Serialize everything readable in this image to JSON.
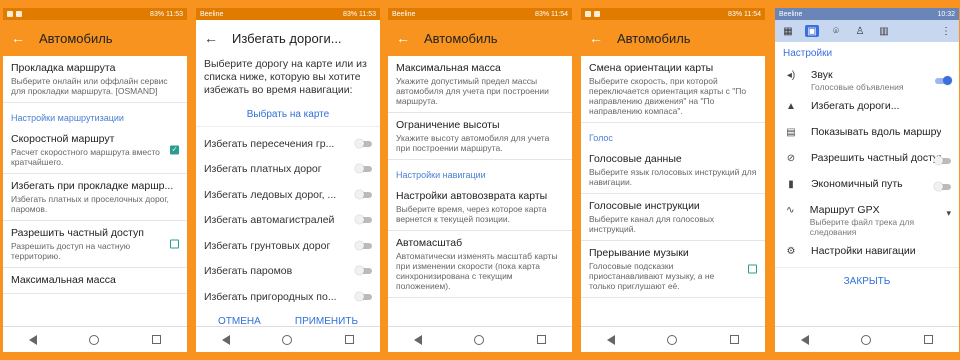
{
  "phone1": {
    "status": {
      "left": "",
      "right": "83% 11:53"
    },
    "title": "Автомобиль",
    "items": [
      {
        "t": "Прокладка маршрута",
        "s": "Выберите онлайн или оффлайн сервис для прокладки маршрута. [OSMAND]"
      },
      {
        "section": "Настройки маршрутизации"
      },
      {
        "t": "Скоростной маршрут",
        "s": "Расчет скоростного маршрута вместо кратчайшего.",
        "check": true
      },
      {
        "t": "Избегать при прокладке маршр...",
        "s": "Избегать платных и проселочных дорог, паромов."
      },
      {
        "t": "Разрешить частный доступ",
        "s": "Разрешить доступ на частную территорию.",
        "check": false
      },
      {
        "t": "Максимальная масса",
        "s": ""
      }
    ]
  },
  "phone2": {
    "status": {
      "left": "Beeline",
      "right": "83% 11:53"
    },
    "title": "Избегать дороги...",
    "intro": "Выберите дорогу на карте или из списка ниже, которую вы хотите избежать во время навигации:",
    "select_on_map": "Выбрать на карте",
    "rows": [
      "Избегать пересечения гр...",
      "Избегать платных дорог",
      "Избегать ледовых дорог, ...",
      "Избегать автомагистралей",
      "Избегать грунтовых дорог",
      "Избегать паромов",
      "Избегать пригородных по..."
    ],
    "cancel": "ОТМЕНА",
    "apply": "ПРИМЕНИТЬ"
  },
  "phone3": {
    "status": {
      "left": "Beeline",
      "right": "83% 11:54"
    },
    "title": "Автомобиль",
    "items": [
      {
        "t": "Максимальная масса",
        "s": "Укажите допустимый предел массы автомобиля для учета при построении маршрута."
      },
      {
        "t": "Ограничение высоты",
        "s": "Укажите высоту автомобиля для учета при построении маршрута."
      },
      {
        "section": "Настройки навигации"
      },
      {
        "t": "Настройки автовозврата карты",
        "s": "Выберите время, через которое карта вернется к текущей позиции."
      },
      {
        "t": "Автомасштаб",
        "s": "Автоматически изменять масштаб карты при изменении скорости (пока карта синхронизирована с текущим положением)."
      }
    ]
  },
  "phone4": {
    "status": {
      "left": "",
      "right": "83% 11:54"
    },
    "title": "Автомобиль",
    "items": [
      {
        "t": "Смена ориентации карты",
        "s": "Выберите скорость, при которой переключается ориентация карты с \"По направлению движения\" на \"По направлению компаса\"."
      },
      {
        "section": "Голос"
      },
      {
        "t": "Голосовые данные",
        "s": "Выберите язык голосовых инструкций для навигации."
      },
      {
        "t": "Голосовые инструкции",
        "s": "Выберите канал для голосовых инструкций."
      },
      {
        "t": "Прерывание музыки",
        "s": "Голосовые подсказки приостанавливают музыку, а не только приглушают её.",
        "check": false
      }
    ]
  },
  "phone5": {
    "status": {
      "left": "Beeline",
      "right": "10:32"
    },
    "header": "Настройки",
    "rows": [
      {
        "icon": "speaker-icon",
        "glyph": "◂)",
        "t": "Звук",
        "s": "Голосовые объявления",
        "toggle": true
      },
      {
        "icon": "warning-icon",
        "glyph": "▲",
        "t": "Избегать дороги...",
        "s": ""
      },
      {
        "icon": "list-icon",
        "glyph": "▤",
        "t": "Показывать вдоль маршру...",
        "s": ""
      },
      {
        "icon": "no-entry-icon",
        "glyph": "⊘",
        "t": "Разрешить частный доступ",
        "s": "",
        "toggle": false
      },
      {
        "icon": "fuel-icon",
        "glyph": "▮",
        "t": "Экономичный путь",
        "s": "",
        "toggle": false
      },
      {
        "icon": "route-icon",
        "glyph": "∿",
        "t": "Маршрут GPX",
        "s": "Выберите файл трека для следования",
        "dropdown": true
      },
      {
        "icon": "gear-icon",
        "glyph": "⚙",
        "t": "Настройки навигации",
        "s": ""
      }
    ],
    "close": "ЗАКРЫТЬ"
  }
}
